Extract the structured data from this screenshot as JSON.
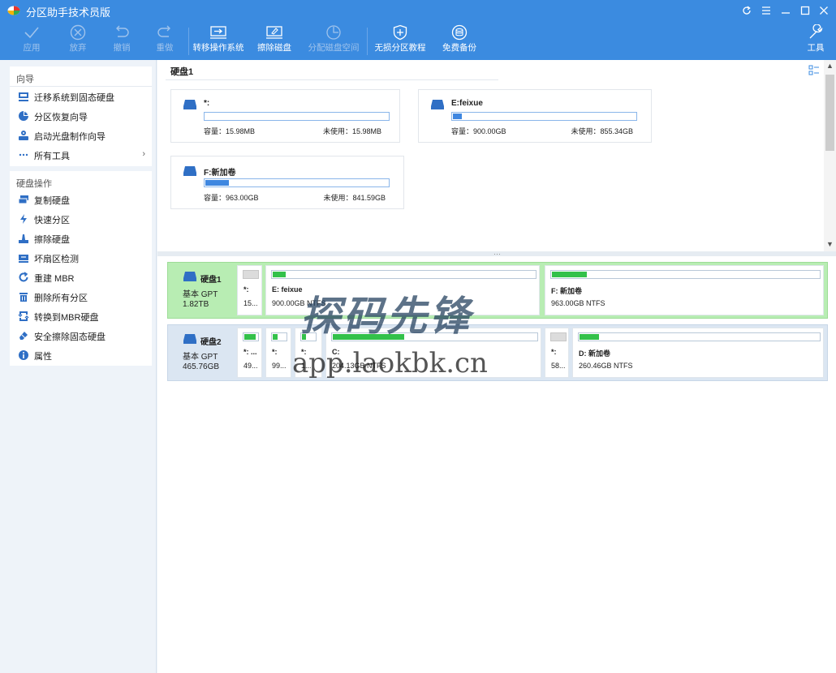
{
  "app": {
    "title": "分区助手技术员版"
  },
  "toolbar": {
    "apply": "应用",
    "discard": "放弃",
    "undo": "撤销",
    "redo": "重做",
    "migrate_os": "转移操作系统",
    "wipe_disk": "擦除磁盘",
    "allocate_space": "分配磁盘空间",
    "lossless_tutorial": "无损分区教程",
    "free_backup": "免费备份",
    "tools": "工具"
  },
  "sidebar": {
    "wizard_title": "向导",
    "wizard_items": [
      {
        "label": "迁移系统到固态硬盘",
        "icon": "migrate-icon"
      },
      {
        "label": "分区恢复向导",
        "icon": "pie-recovery-icon"
      },
      {
        "label": "启动光盘制作向导",
        "icon": "boot-disc-icon"
      },
      {
        "label": "所有工具",
        "icon": "more-icon"
      }
    ],
    "disk_ops_title": "硬盘操作",
    "disk_ops_items": [
      {
        "label": "复制硬盘",
        "icon": "copy-disk-icon"
      },
      {
        "label": "快速分区",
        "icon": "lightning-icon"
      },
      {
        "label": "擦除硬盘",
        "icon": "wipe-icon"
      },
      {
        "label": "坏扇区检测",
        "icon": "bad-sector-icon"
      },
      {
        "label": "重建 MBR",
        "icon": "rebuild-mbr-icon"
      },
      {
        "label": "删除所有分区",
        "icon": "trash-icon"
      },
      {
        "label": "转换到MBR硬盘",
        "icon": "convert-icon"
      },
      {
        "label": "安全擦除固态硬盘",
        "icon": "eraser-icon"
      },
      {
        "label": "属性",
        "icon": "info-icon"
      }
    ]
  },
  "overview": {
    "disk_label": "硬盘1",
    "cards": [
      {
        "name": "*:",
        "capacity": "容量：15.98MB",
        "unused": "未使用：15.98MB",
        "used_fraction": 0.0
      },
      {
        "name": "E:feixue",
        "capacity": "容量：900.00GB",
        "unused": "未使用：855.34GB",
        "used_fraction": 0.05
      },
      {
        "name": "F:新加卷",
        "capacity": "容量：963.00GB",
        "unused": "未使用：841.59GB",
        "used_fraction": 0.13
      }
    ]
  },
  "disks": [
    {
      "name": "硬盘1",
      "type": "基本 GPT",
      "size": "1.82TB",
      "partitions": [
        {
          "name": "*:",
          "info": "15...",
          "used_fraction": 0.0,
          "gray": true
        },
        {
          "name": "E: feixue",
          "info": "900.00GB NTFS",
          "used_fraction": 0.05
        },
        {
          "name": "F: 新加卷",
          "info": "963.00GB NTFS",
          "used_fraction": 0.13
        }
      ]
    },
    {
      "name": "硬盘2",
      "type": "基本 GPT",
      "size": "465.76GB",
      "partitions": [
        {
          "name": "*: ...",
          "info": "49...",
          "used_fraction": 0.85
        },
        {
          "name": "*:",
          "info": "99...",
          "used_fraction": 0.4
        },
        {
          "name": "*:",
          "info": "1...",
          "used_fraction": 0.3
        },
        {
          "name": "C:",
          "info": "204.13GB NTFS",
          "used_fraction": 0.35
        },
        {
          "name": "*:",
          "info": "58...",
          "used_fraction": 0.0,
          "gray": true
        },
        {
          "name": "D: 新加卷",
          "info": "260.46GB NTFS",
          "used_fraction": 0.08
        }
      ]
    }
  ],
  "watermark": {
    "cn": "探码先锋",
    "url": "app.laokbk.cn"
  }
}
